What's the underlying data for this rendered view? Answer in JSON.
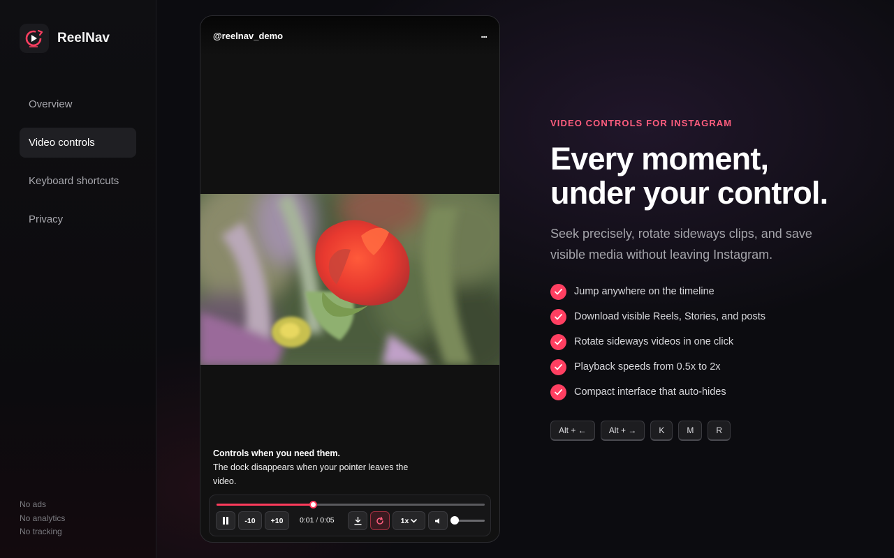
{
  "brand": {
    "name": "ReelNav"
  },
  "sidebar": {
    "items": [
      {
        "label": "Overview",
        "active": false
      },
      {
        "label": "Video controls",
        "active": true
      },
      {
        "label": "Keyboard shortcuts",
        "active": false
      },
      {
        "label": "Privacy",
        "active": false
      }
    ],
    "footer": [
      "No ads",
      "No analytics",
      "No tracking"
    ]
  },
  "phone": {
    "username": "@reelnav_demo",
    "more": "...",
    "caption_title": "Controls when you need them.",
    "caption_body": "The dock disappears when your pointer leaves the video.",
    "player": {
      "progress_fraction": 0.36,
      "volume_fraction": 0.0,
      "back_label": "-10",
      "forward_label": "+10",
      "current_time": "0:01",
      "separator": "/",
      "duration": "0:05",
      "speed_label": "1x"
    }
  },
  "hero": {
    "eyebrow": "VIDEO CONTROLS FOR INSTAGRAM",
    "headline_line1": "Every moment,",
    "headline_line2": "under your control.",
    "subtitle": "Seek precisely, rotate sideways clips, and save visible media without leaving Instagram.",
    "features": [
      "Jump anywhere on the timeline",
      "Download visible Reels, Stories, and posts",
      "Rotate sideways videos in one click",
      "Playback speeds from 0.5x to 2x",
      "Compact interface that auto-hides"
    ],
    "keys": [
      "Alt + ←",
      "Alt + →",
      "K",
      "M",
      "R"
    ]
  },
  "colors": {
    "accent": "#ff3f61",
    "eyebrow": "#ff5d7e",
    "background": "#0c0c10"
  }
}
